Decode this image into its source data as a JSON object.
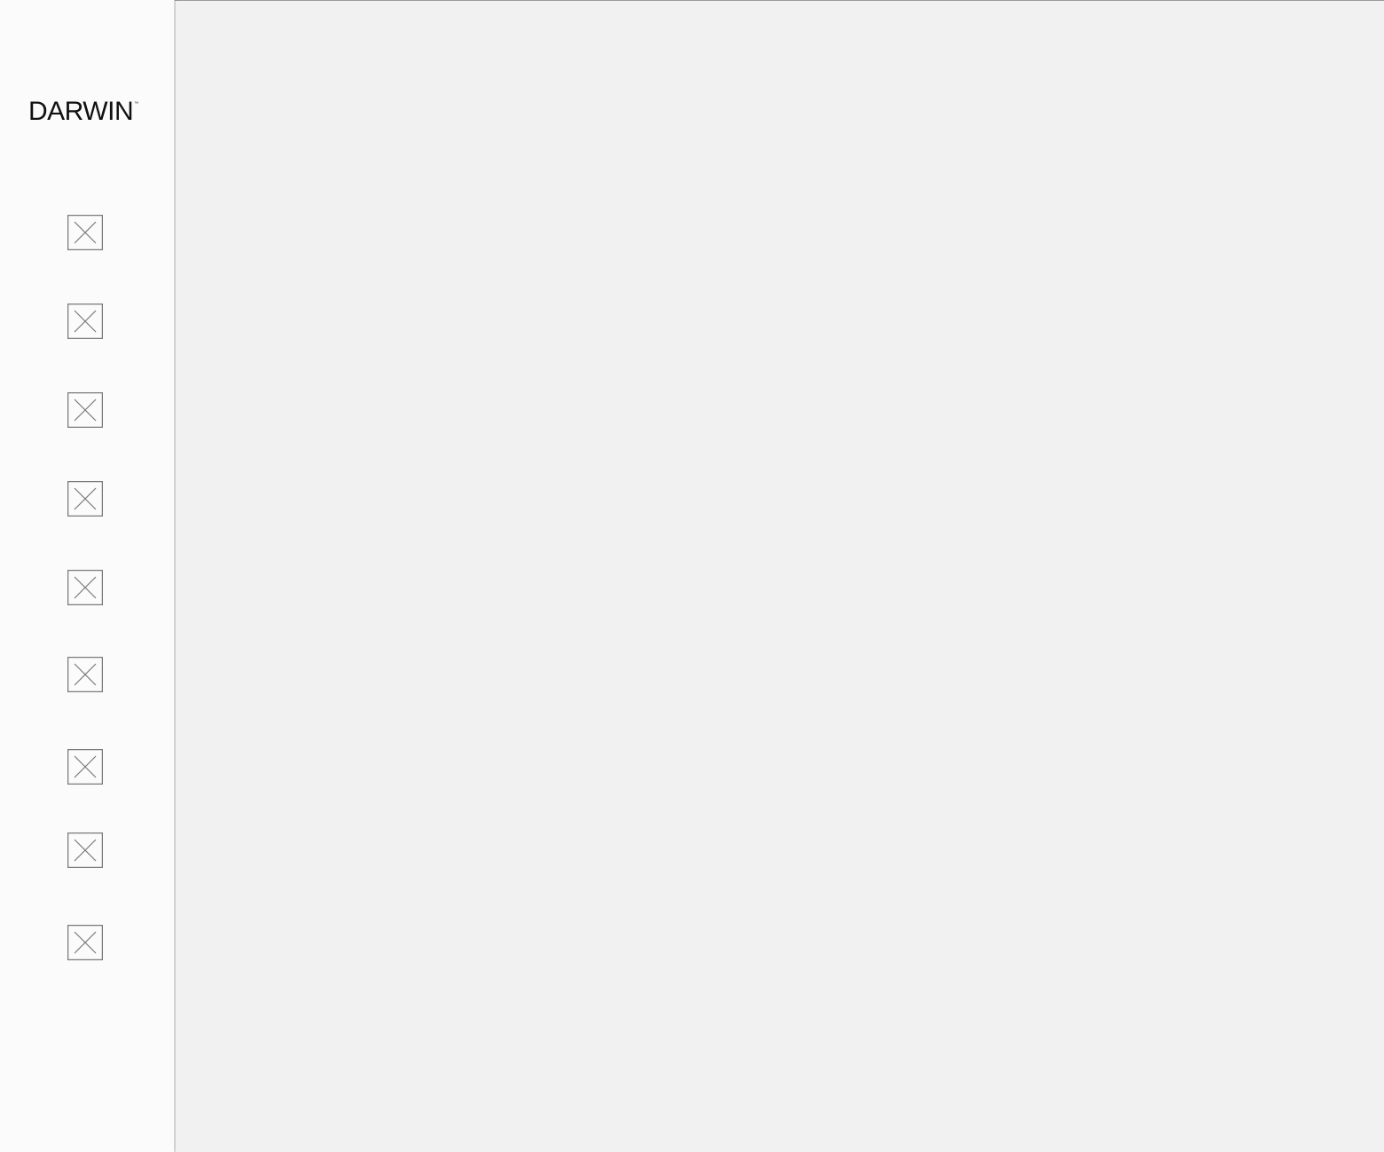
{
  "sidebar": {
    "logo": {
      "text": "DARWIN",
      "tm": "™"
    },
    "items": [
      {
        "icon": "broken-image-icon"
      },
      {
        "icon": "broken-image-icon"
      },
      {
        "icon": "broken-image-icon"
      },
      {
        "icon": "broken-image-icon"
      },
      {
        "icon": "broken-image-icon"
      },
      {
        "icon": "broken-image-icon"
      },
      {
        "icon": "broken-image-icon"
      },
      {
        "icon": "broken-image-icon"
      },
      {
        "icon": "broken-image-icon"
      }
    ]
  },
  "colors": {
    "background": "#f1f1f1",
    "sidebar": "#fbfbfb",
    "icon_stroke": "#7a7a7a",
    "logo": "#111111"
  }
}
